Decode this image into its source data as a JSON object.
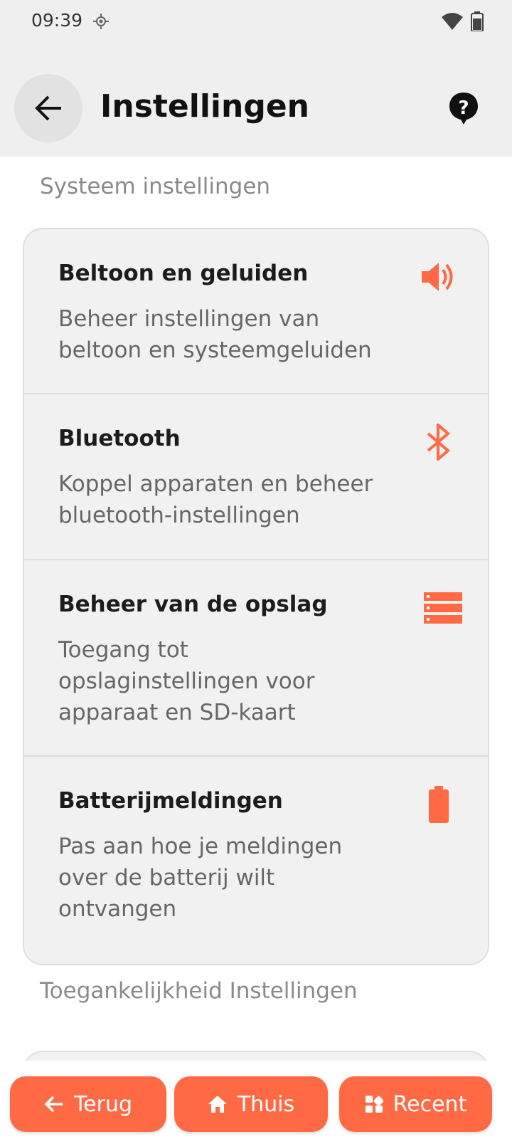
{
  "status_bar": {
    "time": "09:39"
  },
  "header": {
    "title": "Instellingen"
  },
  "sections": [
    {
      "title": "Systeem instellingen",
      "items": [
        {
          "title": "Beltoon en geluiden",
          "description": "Beheer instellingen van beltoon en systeemgeluiden",
          "icon": "speaker-icon"
        },
        {
          "title": "Bluetooth",
          "description": "Koppel apparaten en beheer bluetooth-instellingen",
          "icon": "bluetooth-icon"
        },
        {
          "title": "Beheer van de opslag",
          "description": "Toegang tot opslaginstellingen voor apparaat en SD-kaart",
          "icon": "storage-icon"
        },
        {
          "title": "Batterijmeldingen",
          "description": "Pas aan hoe je meldingen over de batterij wilt ontvangen",
          "icon": "battery-icon"
        }
      ]
    },
    {
      "title": "Toegankelijkheid Instellingen"
    }
  ],
  "bottom_nav": {
    "back": "Terug",
    "home": "Thuis",
    "recent": "Recent"
  },
  "colors": {
    "accent": "#ff6a45",
    "topbar": "#efefef",
    "card": "#f1f1f1"
  }
}
